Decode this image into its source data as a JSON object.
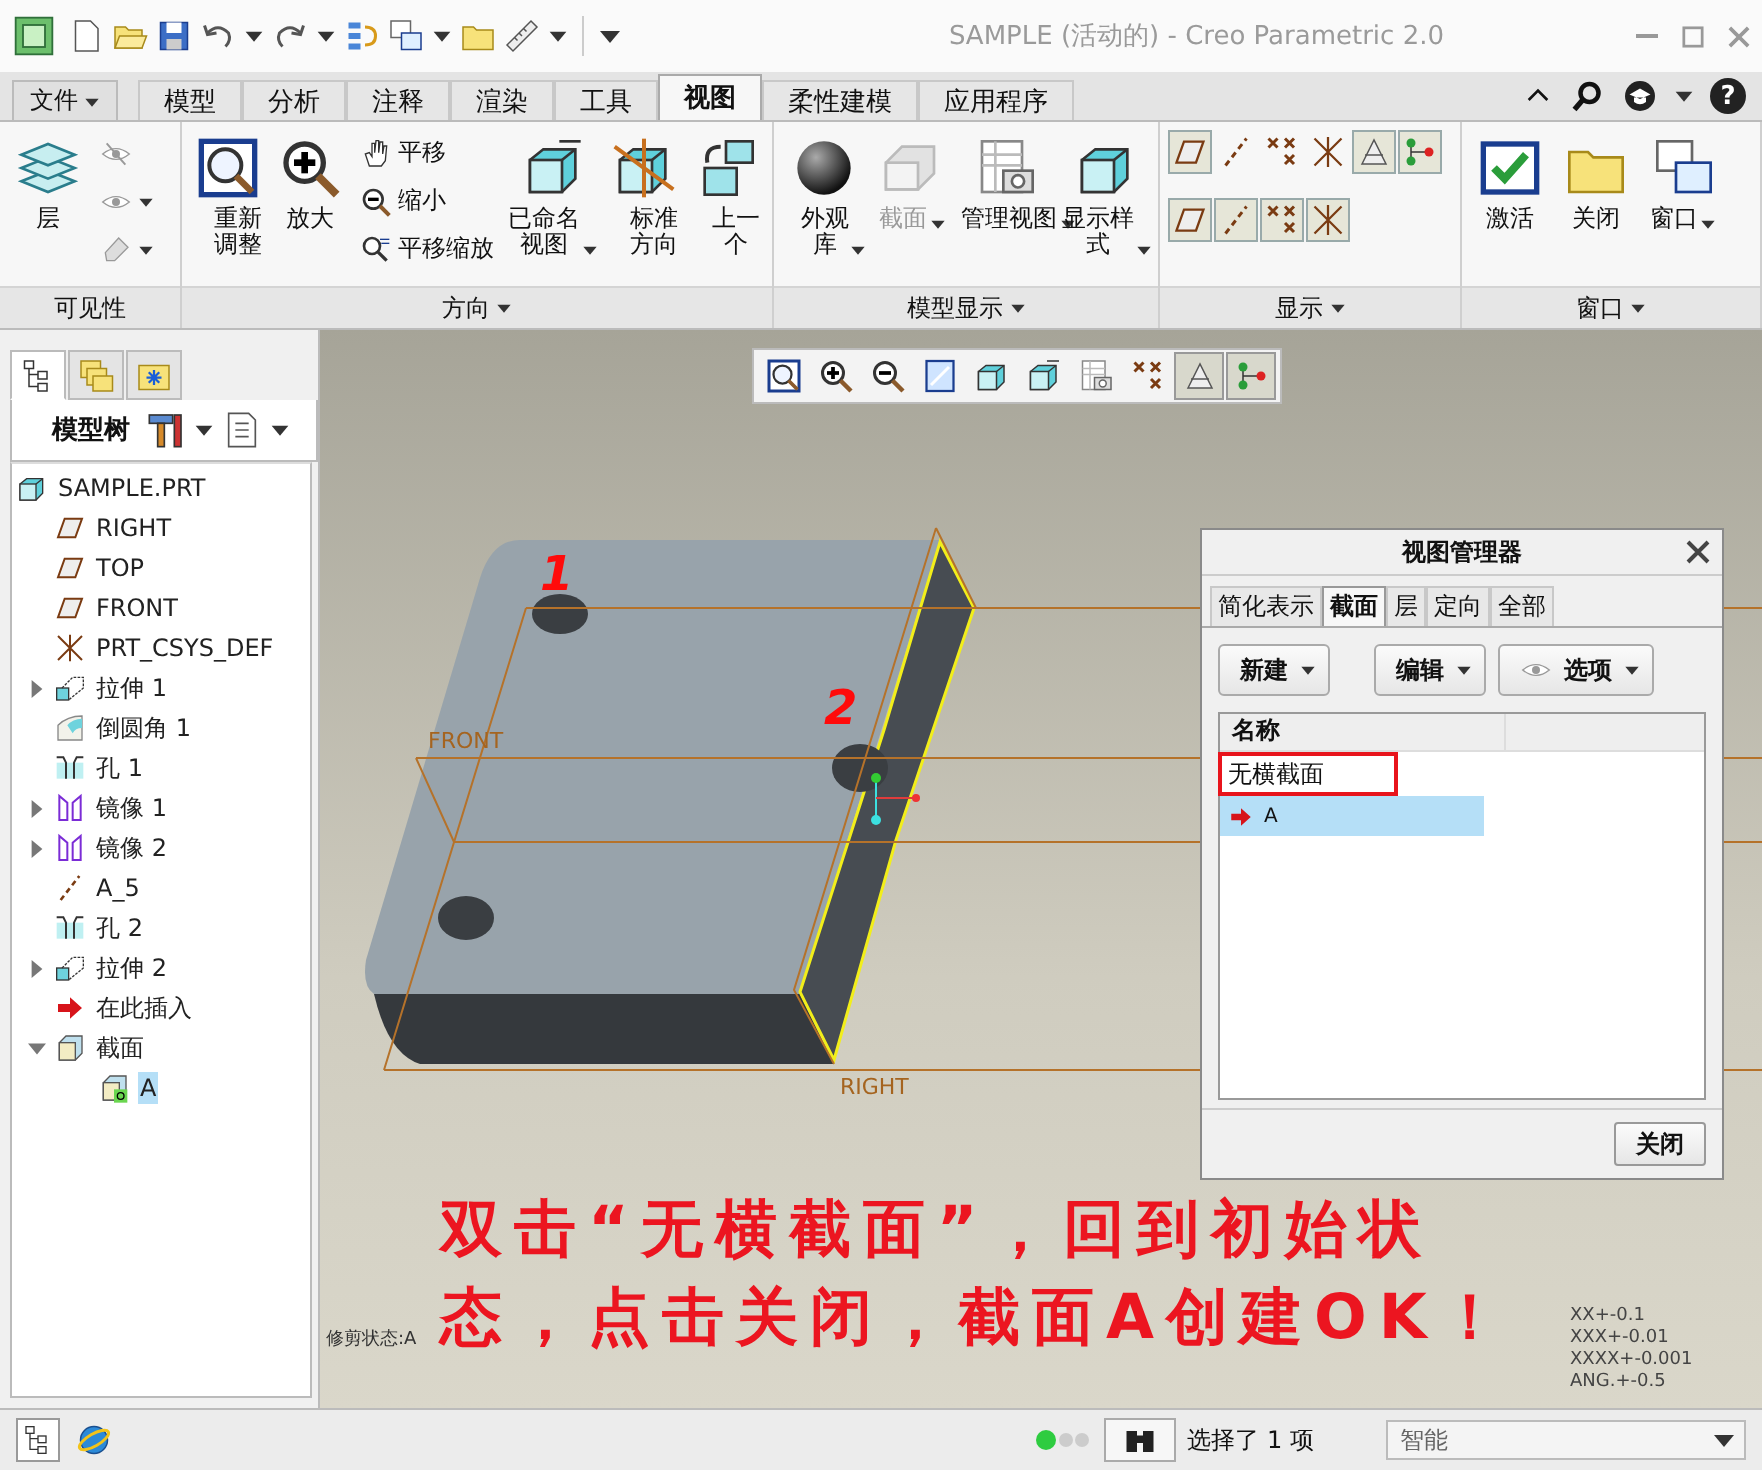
{
  "window": {
    "title": "SAMPLE (活动的) - Creo Parametric 2.0"
  },
  "file_menu": {
    "label": "文件"
  },
  "tabs": [
    {
      "label": "模型",
      "selected": false
    },
    {
      "label": "分析",
      "selected": false
    },
    {
      "label": "注释",
      "selected": false
    },
    {
      "label": "渲染",
      "selected": false
    },
    {
      "label": "工具",
      "selected": false
    },
    {
      "label": "视图",
      "selected": true
    },
    {
      "label": "柔性建模",
      "selected": false
    },
    {
      "label": "应用程序",
      "selected": false
    }
  ],
  "help_label": "?",
  "ribbon_groups": [
    {
      "label": "可见性",
      "launcher": false,
      "items": [
        {
          "kind": "large",
          "label": "层",
          "dropdown": false,
          "disabled": false
        },
        {
          "kind": "stack",
          "entries": [
            {
              "dropdown": false
            },
            {
              "dropdown": true
            },
            {
              "dropdown": true
            }
          ]
        }
      ]
    },
    {
      "label": "方向",
      "launcher": true,
      "items": [
        {
          "kind": "large",
          "label": "重新调整",
          "dropdown": false,
          "disabled": false
        },
        {
          "kind": "large",
          "label": "放大",
          "dropdown": false,
          "disabled": false
        },
        {
          "kind": "stack",
          "entries": [
            {
              "label": "平移",
              "dropdown": false
            },
            {
              "label": "缩小",
              "dropdown": false
            },
            {
              "label": "平移缩放",
              "dropdown": false
            }
          ]
        },
        {
          "kind": "large",
          "label": "已命名视图",
          "dropdown": true,
          "disabled": false
        },
        {
          "kind": "large",
          "label": "标准方向",
          "dropdown": false,
          "disabled": false
        },
        {
          "kind": "large",
          "label": "上一个",
          "dropdown": false,
          "disabled": false
        }
      ]
    },
    {
      "label": "模型显示",
      "launcher": true,
      "items": [
        {
          "kind": "large",
          "label": "外观库",
          "dropdown": true,
          "disabled": false
        },
        {
          "kind": "large",
          "label": "截面",
          "dropdown": true,
          "disabled": true
        },
        {
          "kind": "large",
          "label": "管理视图",
          "dropdown": true,
          "disabled": false
        },
        {
          "kind": "large",
          "label": "显示样式",
          "dropdown": true,
          "disabled": false
        }
      ]
    },
    {
      "label": "显示",
      "launcher": true,
      "items": [
        {
          "kind": "toggles",
          "rows": [
            [
              {
                "on": true
              },
              {
                "on": false
              },
              {
                "on": false
              },
              {
                "on": false
              },
              {
                "on": true
              },
              {
                "on": true
              }
            ],
            [
              {
                "on": true
              },
              {
                "on": true
              },
              {
                "on": true
              },
              {
                "on": true
              }
            ]
          ]
        }
      ]
    },
    {
      "label": "窗口",
      "launcher": true,
      "items": [
        {
          "kind": "large",
          "label": "激活",
          "dropdown": false,
          "disabled": false
        },
        {
          "kind": "large",
          "label": "关闭",
          "dropdown": false,
          "disabled": false
        },
        {
          "kind": "large",
          "label": "窗口",
          "dropdown": true,
          "disabled": false
        }
      ]
    }
  ],
  "panel_tabs": [
    {
      "selected": true
    },
    {
      "selected": false
    },
    {
      "selected": false
    }
  ],
  "panel_header": "模型树",
  "tree": [
    {
      "kind": "part",
      "label": "SAMPLE.PRT",
      "selected": false,
      "children": [
        {
          "kind": "datum-plane",
          "label": "RIGHT",
          "selected": false
        },
        {
          "kind": "datum-plane",
          "label": "TOP",
          "selected": false
        },
        {
          "kind": "datum-plane",
          "label": "FRONT",
          "selected": false
        },
        {
          "kind": "csys",
          "label": "PRT_CSYS_DEF",
          "selected": false
        },
        {
          "kind": "extrude",
          "label": "拉伸 1",
          "selected": false,
          "expanded": false
        },
        {
          "kind": "round",
          "label": "倒圆角 1",
          "selected": false
        },
        {
          "kind": "hole",
          "label": "孔 1",
          "selected": false
        },
        {
          "kind": "mirror",
          "label": "镜像 1",
          "selected": false,
          "expanded": false
        },
        {
          "kind": "mirror",
          "label": "镜像 2",
          "selected": false,
          "expanded": false
        },
        {
          "kind": "datum-axis",
          "label": "A_5",
          "selected": false
        },
        {
          "kind": "hole",
          "label": "孔 2",
          "selected": false
        },
        {
          "kind": "extrude",
          "label": "拉伸 2",
          "selected": false,
          "expanded": false
        },
        {
          "kind": "insert",
          "label": "在此插入",
          "selected": false
        },
        {
          "kind": "section",
          "label": "截面",
          "selected": false,
          "expanded": true,
          "children": [
            {
              "kind": "section-item",
              "label": "A",
              "selected": true
            }
          ]
        }
      ]
    }
  ],
  "view_toolbar": [
    {
      "on": false
    },
    {
      "on": false
    },
    {
      "on": false
    },
    {
      "on": false
    },
    {
      "on": false
    },
    {
      "on": false
    },
    {
      "on": false
    },
    {
      "on": false
    },
    {
      "on": true
    },
    {
      "on": true
    }
  ],
  "model": {
    "plane_labels": [
      "FRONT",
      "RIGHT"
    ],
    "callouts": [
      "1",
      "2"
    ]
  },
  "view_manager": {
    "title": "视图管理器",
    "tabs": [
      {
        "label": "简化表示",
        "selected": false
      },
      {
        "label": "截面",
        "selected": true
      },
      {
        "label": "层",
        "selected": false
      },
      {
        "label": "定向",
        "selected": false
      },
      {
        "label": "全部",
        "selected": false
      }
    ],
    "buttons": [
      {
        "label": "新建",
        "dropdown": true
      },
      {
        "label": "编辑",
        "dropdown": true
      },
      {
        "label": "选项",
        "dropdown": true
      }
    ],
    "columns": [
      "名称"
    ],
    "rows": [
      {
        "label": "无横截面",
        "selected": false,
        "active": false,
        "outlined": true
      },
      {
        "label": "A",
        "selected": true,
        "active": true,
        "outlined": false
      }
    ],
    "close_label": "关闭"
  },
  "annotation": "双击“无横截面”，回到初始状态，点击关闭，截面A创建OK！",
  "clip_status": "修剪状态:A",
  "tolerances": [
    "XX+-0.1",
    "XXX+-0.01",
    "XXXX+-0.001",
    "ANG.+-0.5"
  ],
  "status_bar": {
    "selection": "选择了 1 项",
    "filter": "智能"
  }
}
